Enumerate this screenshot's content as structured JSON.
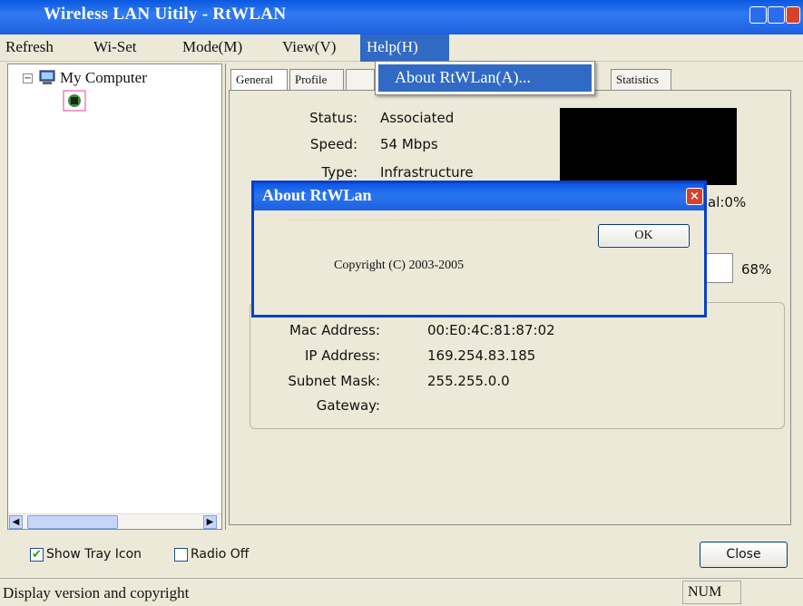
{
  "window": {
    "title": "Wireless LAN Uitily - RtWLAN"
  },
  "menu": {
    "items": [
      "Refresh",
      "Wi-Set",
      "Mode(M)",
      "View(V)",
      "Help(H)"
    ],
    "help_dropdown_item": "About RtWLan(A)..."
  },
  "tree": {
    "root": "My Computer"
  },
  "tabs": [
    "General",
    "Profile",
    "Statistics"
  ],
  "general": {
    "status_label": "Status:",
    "status": "Associated",
    "speed_label": "Speed:",
    "speed": "54 Mbps",
    "type_label": "Type:",
    "type": "Infrastructure",
    "signal_text": "al:0%",
    "link_quality_text": "68%",
    "mac_label": "Mac Address:",
    "mac": "00:E0:4C:81:87:02",
    "ip_label": "IP Address:",
    "ip": "169.254.83.185",
    "subnet_label": "Subnet Mask:",
    "subnet": "255.255.0.0",
    "gateway_label": "Gateway:",
    "gateway": ""
  },
  "dialog": {
    "title": "About RtWLan",
    "copyright": "Copyright (C) 2003-2005",
    "ok_label": "OK"
  },
  "bottom": {
    "show_tray_icon_label": "Show Tray Icon",
    "show_tray_icon_checked": true,
    "radio_off_label": "Radio Off",
    "radio_off_checked": false,
    "close_label": "Close"
  },
  "status_bar": {
    "text": "Display version and copyright",
    "num": "NUM"
  },
  "colors": {
    "title_blue": "#1d5fe0",
    "selection_blue": "#316ac5",
    "chrome": "#ece9d8"
  }
}
